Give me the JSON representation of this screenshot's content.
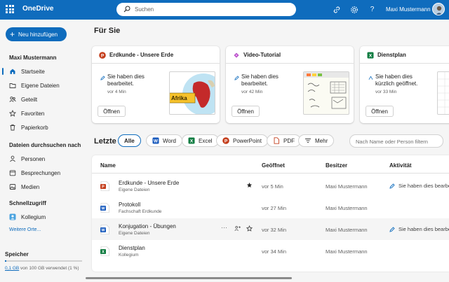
{
  "app": {
    "title": "OneDrive"
  },
  "search": {
    "placeholder": "Suchen"
  },
  "header": {
    "user_name": "Maxi Mustermann"
  },
  "colors": {
    "accent": "#0f6cbd",
    "powerpoint": "#c43e1c",
    "word": "#185abd",
    "excel": "#107c41",
    "clipchamp": "#b146c2"
  },
  "sidebar": {
    "new_button": "Neu hinzufügen",
    "user_heading": "Maxi Mustermann",
    "items": [
      {
        "label": "Startseite",
        "icon": "home-icon",
        "active": true
      },
      {
        "label": "Eigene Dateien",
        "icon": "folder-icon"
      },
      {
        "label": "Geteilt",
        "icon": "people-icon"
      },
      {
        "label": "Favoriten",
        "icon": "star-icon"
      },
      {
        "label": "Papierkorb",
        "icon": "trash-icon"
      }
    ],
    "browse_heading": "Dateien durchsuchen nach",
    "browse_items": [
      {
        "label": "Personen",
        "icon": "person-icon"
      },
      {
        "label": "Besprechungen",
        "icon": "calendar-icon"
      },
      {
        "label": "Medien",
        "icon": "image-icon"
      }
    ],
    "quick_heading": "Schnellzugriff",
    "quick_items": [
      {
        "label": "Kollegium",
        "icon": "group-icon"
      }
    ],
    "more_places": "Weitere Orte...",
    "storage": {
      "title": "Speicher",
      "used": "0,1 GB",
      "rest": " von 100 GB verwendet (1 %)",
      "fraction": 0.01
    }
  },
  "for_you": {
    "title": "Für Sie",
    "cards": [
      {
        "title": "Erdkunde - Unsere Erde",
        "type": "powerpoint-icon",
        "activity": "Sie haben dies bearbeitet.",
        "time": "vor 4 Min",
        "button": "Öffnen",
        "thumb_label": "Afrika"
      },
      {
        "title": "Video-Tutorial",
        "type": "clipchamp-icon",
        "activity": "Sie haben dies bearbeitet.",
        "time": "vor 42 Min",
        "button": "Öffnen"
      },
      {
        "title": "Dienstplan",
        "type": "excel-icon",
        "activity": "Sie haben dies kürzlich geöffnet.",
        "time": "vor 33 Min",
        "button": "Öffnen"
      }
    ]
  },
  "recent": {
    "title": "Letzte",
    "filters": [
      {
        "label": "Alle",
        "icon": ""
      },
      {
        "label": "Word",
        "icon": "word-icon"
      },
      {
        "label": "Excel",
        "icon": "excel-icon"
      },
      {
        "label": "PowerPoint",
        "icon": "powerpoint-icon"
      },
      {
        "label": "PDF",
        "icon": "pdf-icon"
      },
      {
        "label": "Mehr",
        "icon": "filter-icon"
      }
    ],
    "filter_placeholder": "Nach Name oder Person filtern",
    "columns": {
      "name": "Name",
      "opened": "Geöffnet",
      "owner": "Besitzer",
      "activity": "Aktivität"
    },
    "rows": [
      {
        "name": "Erdkunde - Unsere Erde",
        "location": "Eigene Dateien",
        "opened": "vor 5 Min",
        "owner": "Maxi Mustermann",
        "activity": "Sie haben dies bearbeitet",
        "type": "powerpoint-icon",
        "favorite": true
      },
      {
        "name": "Protokoll",
        "location": "Fachschaft Erdkunde",
        "opened": "vor 27 Min",
        "owner": "Maxi Mustermann",
        "activity": "",
        "type": "word-icon"
      },
      {
        "name": "Konjugation - Übungen",
        "location": "Eigene Dateien",
        "opened": "vor 32 Min",
        "owner": "Maxi Mustermann",
        "activity": "Sie haben dies bearbeitet",
        "type": "word-icon",
        "hover": true
      },
      {
        "name": "Dienstplan",
        "location": "Kollegium",
        "opened": "vor 34 Min",
        "owner": "Maxi Mustermann",
        "activity": "",
        "type": "excel-icon"
      }
    ]
  }
}
